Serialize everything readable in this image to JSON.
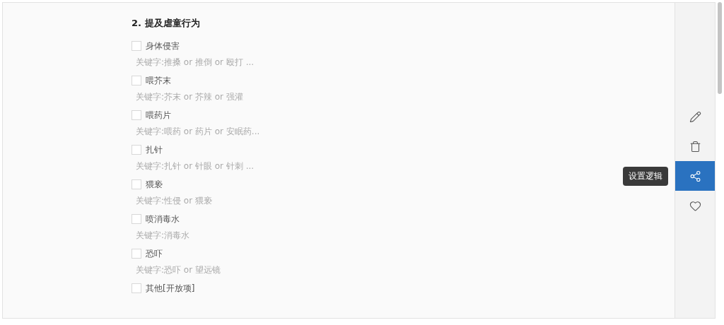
{
  "question": {
    "title": "2. 提及虐童行为",
    "options": [
      {
        "label": "身体侵害",
        "keywords": "关键字:推搡 or 推倒 or 殴打 ...",
        "checked": false
      },
      {
        "label": "喂芥末",
        "keywords": "关键字:芥末 or 芥辣 or 强灌",
        "checked": false
      },
      {
        "label": "喂药片",
        "keywords": "关键字:喂药 or 药片 or 安眠药...",
        "checked": false
      },
      {
        "label": "扎针",
        "keywords": "关键字:扎针 or 针眼 or 针刺 ...",
        "checked": false
      },
      {
        "label": "猥亵",
        "keywords": "关键字:性侵 or 猥亵",
        "checked": false
      },
      {
        "label": "喷消毒水",
        "keywords": "关键字:消毒水",
        "checked": false
      },
      {
        "label": "恐吓",
        "keywords": "关键字:恐吓 or 望远镜",
        "checked": false
      },
      {
        "label": "其他[开放项]",
        "checked": false
      }
    ]
  },
  "toolbar": [
    {
      "kind": "edit",
      "selected": false
    },
    {
      "kind": "delete",
      "selected": false
    },
    {
      "kind": "logic",
      "selected": true,
      "tooltip": "设置逻辑"
    },
    {
      "kind": "favorite",
      "selected": false
    }
  ]
}
